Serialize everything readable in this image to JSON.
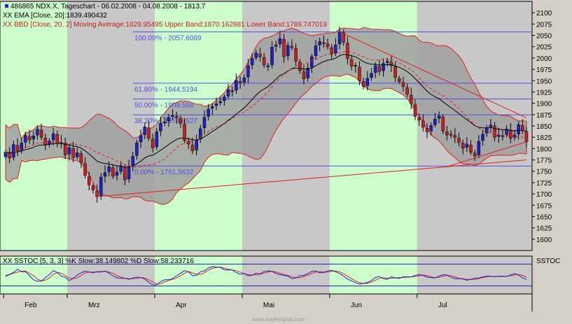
{
  "header": {
    "line1": "486865  NDX.X, Tageschart - 06.02.2008 - 04.08.2008 - 1813.7",
    "line2": "XX EMA [Close, 20]:1839.490432",
    "line3": "XX BBD [Close, 20, 2] Moving Average:1829.95495 Upper Band:1870.162881 Lower Band:1789.747019"
  },
  "stoch_header": "XX SSTOC [5, 3, 3] %K Slow:38.149802 %D Slow:58.233716",
  "stoch_label": "SSTOC",
  "watermark": "www.tradesignal.com",
  "colors": {
    "up": "#2020c8",
    "down": "#c82020",
    "band_fill": "#a0a0a0",
    "band_line": "#e02020",
    "ema": "#000000",
    "fib": "#5050e0",
    "trend": "#e02020",
    "green_bg": "#ccffcc",
    "gray_bg": "#c8c8c8"
  },
  "chart_data": {
    "type": "candlestick",
    "ylim": [
      1575,
      2125
    ],
    "yticks": [
      1600,
      1625,
      1650,
      1675,
      1700,
      1725,
      1750,
      1775,
      1800,
      1825,
      1850,
      1875,
      1900,
      1925,
      1950,
      1975,
      2000,
      2025,
      2050,
      2075,
      2100
    ],
    "months": [
      "Feb",
      "Mrz",
      "Apr",
      "Mai",
      "Jun",
      "Jul"
    ],
    "fib_levels": [
      {
        "value": 2057.6,
        "label": "100.00% - 2057.6089"
      },
      {
        "value": 1944.5,
        "label": "61.80% - 1944.5194"
      },
      {
        "value": 1909.6,
        "label": "50.00% - 1909.586"
      },
      {
        "value": 1874.6,
        "label": "38.20% - 1874.6527"
      },
      {
        "value": 1761.6,
        "label": "0.00% - 1761.5632"
      }
    ],
    "close": [
      1792,
      1779,
      1809,
      1795,
      1812,
      1829,
      1819,
      1828,
      1843,
      1825,
      1808,
      1817,
      1833,
      1811,
      1814,
      1786,
      1802,
      1780,
      1791,
      1769,
      1741,
      1720,
      1709,
      1694,
      1737,
      1747,
      1760,
      1739,
      1748,
      1761,
      1731,
      1761,
      1783,
      1813,
      1829,
      1848,
      1823,
      1802,
      1837,
      1856,
      1859,
      1869,
      1873,
      1869,
      1856,
      1818,
      1810,
      1795,
      1819,
      1844,
      1869,
      1887,
      1893,
      1899,
      1904,
      1914,
      1930,
      1927,
      1950,
      1945,
      1956,
      1983,
      1999,
      2011,
      2003,
      1985,
      1983,
      2024,
      2029,
      2043,
      2003,
      2028,
      2023,
      1993,
      1972,
      1954,
      1978,
      2003,
      2027,
      2036,
      2033,
      2025,
      2009,
      2029,
      2058,
      2035,
      1999,
      1982,
      1982,
      1950,
      1937,
      1955,
      1966,
      1983,
      1970,
      1988,
      1993,
      1983,
      1957,
      1948,
      1937,
      1920,
      1899,
      1871,
      1863,
      1847,
      1837,
      1851,
      1865,
      1872,
      1839,
      1830,
      1831,
      1825,
      1814,
      1801,
      1810,
      1792,
      1784,
      1816,
      1832,
      1846,
      1852,
      1825,
      1830,
      1829,
      1843,
      1823,
      1830,
      1853,
      1840,
      1815
    ],
    "k_slow": [
      46,
      52,
      57,
      66,
      59,
      59,
      48,
      37,
      33,
      33,
      43,
      51,
      62,
      57,
      47,
      44,
      35,
      41,
      50,
      56,
      61,
      58,
      56,
      59,
      59,
      61,
      55,
      48,
      42,
      41,
      41,
      38,
      42,
      44,
      43,
      39,
      30,
      23,
      23,
      32,
      37,
      37,
      40,
      48,
      55,
      62,
      59,
      48,
      49,
      59,
      61,
      69,
      73,
      72,
      71,
      64,
      64,
      64,
      57,
      52,
      54,
      48,
      49,
      55,
      53,
      60,
      61,
      60,
      54,
      51,
      49,
      47,
      40,
      42,
      48,
      49,
      54,
      60,
      61,
      56,
      57,
      61,
      63,
      59,
      54,
      47,
      39,
      34,
      29,
      25,
      27,
      30,
      35,
      43,
      46,
      40,
      38,
      45,
      42,
      41,
      45,
      45,
      45,
      49,
      51,
      49,
      44,
      43,
      42,
      47,
      51,
      50,
      44,
      40,
      40,
      39,
      36,
      38,
      41,
      42,
      45,
      47,
      47,
      45,
      47,
      47,
      46,
      50,
      54,
      50,
      42,
      38
    ],
    "d_slow": [
      49,
      51,
      55,
      58,
      61,
      61,
      55,
      48,
      39,
      34,
      36,
      42,
      52,
      57,
      55,
      49,
      42,
      40,
      42,
      49,
      56,
      58,
      58,
      58,
      58,
      60,
      58,
      55,
      48,
      44,
      41,
      40,
      40,
      41,
      43,
      42,
      37,
      31,
      25,
      26,
      31,
      35,
      38,
      42,
      48,
      55,
      59,
      56,
      52,
      52,
      56,
      63,
      68,
      71,
      72,
      69,
      66,
      64,
      62,
      58,
      54,
      51,
      50,
      51,
      52,
      56,
      58,
      60,
      58,
      55,
      51,
      49,
      45,
      43,
      43,
      46,
      50,
      54,
      58,
      59,
      58,
      58,
      60,
      61,
      59,
      53,
      47,
      40,
      34,
      29,
      27,
      27,
      31,
      36,
      41,
      43,
      41,
      41,
      42,
      43,
      43,
      44,
      45,
      46,
      48,
      50,
      48,
      45,
      43,
      44,
      47,
      49,
      48,
      45,
      41,
      40,
      38,
      38,
      38,
      40,
      43,
      45,
      46,
      46,
      46,
      46,
      47,
      48,
      50,
      51,
      49,
      43
    ]
  }
}
